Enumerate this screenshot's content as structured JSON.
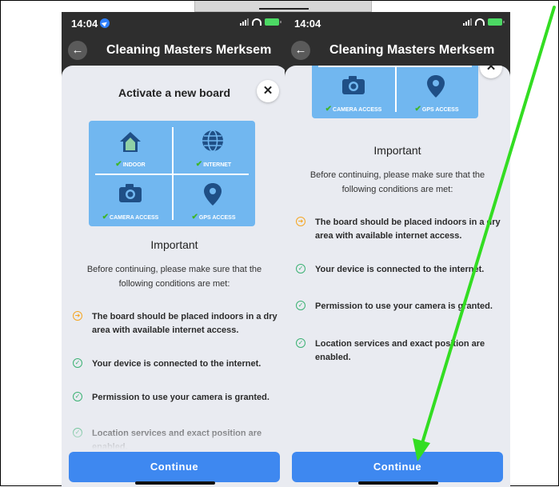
{
  "status": {
    "time": "14:04"
  },
  "nav": {
    "title": "Cleaning Masters Merksem",
    "back_icon": "back-arrow-icon"
  },
  "sheet": {
    "title": "Activate a new board",
    "close_icon": "close-icon",
    "board": {
      "indoor": "INDOOR",
      "internet": "INTERNET",
      "camera": "CAMERA ACCESS",
      "gps": "GPS ACCESS"
    },
    "important": "Important",
    "intro": "Before continuing, please make sure that the following conditions are met:",
    "conditions": [
      {
        "text": "The board should be placed indoors in a dry area with available internet access.",
        "status": "warning"
      },
      {
        "text": "Your device is connected to the internet.",
        "status": "ok"
      },
      {
        "text": "Permission to use your camera is granted.",
        "status": "ok"
      },
      {
        "text": "Location services and exact position are enabled.",
        "status": "ok"
      }
    ],
    "continue_label": "Continue"
  },
  "colors": {
    "accent": "#3e88f0",
    "board_bg": "#71b7f0",
    "warning": "#f5a623",
    "ok": "#3bb273",
    "annotation_arrow": "#33dd22"
  }
}
